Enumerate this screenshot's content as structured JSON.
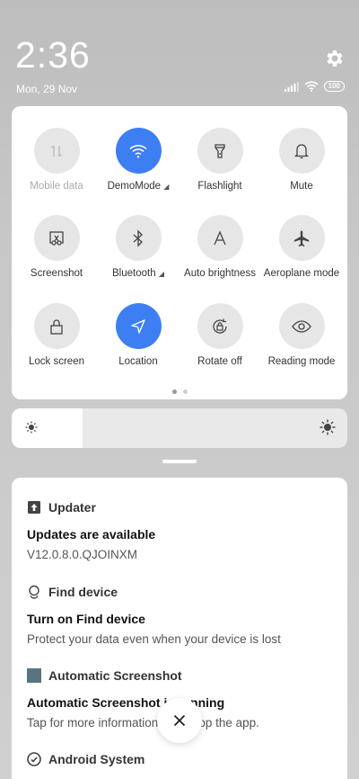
{
  "status": {
    "time": "2:36",
    "date": "Mon, 29 Nov",
    "battery": "100"
  },
  "quick_settings": {
    "tiles": [
      {
        "label": "Mobile data",
        "icon": "mobile-data-icon",
        "active": false
      },
      {
        "label": "DemoMode",
        "icon": "wifi-icon",
        "active": true
      },
      {
        "label": "Flashlight",
        "icon": "flashlight-icon",
        "active": false
      },
      {
        "label": "Mute",
        "icon": "bell-icon",
        "active": false
      },
      {
        "label": "Screenshot",
        "icon": "screenshot-icon",
        "active": false
      },
      {
        "label": "Bluetooth",
        "icon": "bluetooth-icon",
        "active": false
      },
      {
        "label": "Auto brightness",
        "icon": "auto-brightness-icon",
        "active": false
      },
      {
        "label": "Aeroplane mode",
        "icon": "airplane-icon",
        "active": false
      },
      {
        "label": "Lock screen",
        "icon": "lock-icon",
        "active": false
      },
      {
        "label": "Location",
        "icon": "location-icon",
        "active": true
      },
      {
        "label": "Rotate off",
        "icon": "rotate-lock-icon",
        "active": false
      },
      {
        "label": "Reading mode",
        "icon": "eye-icon",
        "active": false
      }
    ],
    "accent": "#3d7ff2",
    "page": 1,
    "pages": 2
  },
  "brightness": {
    "level": 0.21
  },
  "notifications": [
    {
      "app": "Updater",
      "title": "Updates are available",
      "body": "V12.0.8.0.QJOINXM"
    },
    {
      "app": "Find device",
      "title": "Turn on Find device",
      "body": "Protect your data even when your device is lost"
    },
    {
      "app": "Automatic Screenshot",
      "title": "Automatic Screenshot is running",
      "body": "Tap for more information or to stop the app."
    },
    {
      "app": "Android System",
      "title": "",
      "body": ""
    }
  ]
}
